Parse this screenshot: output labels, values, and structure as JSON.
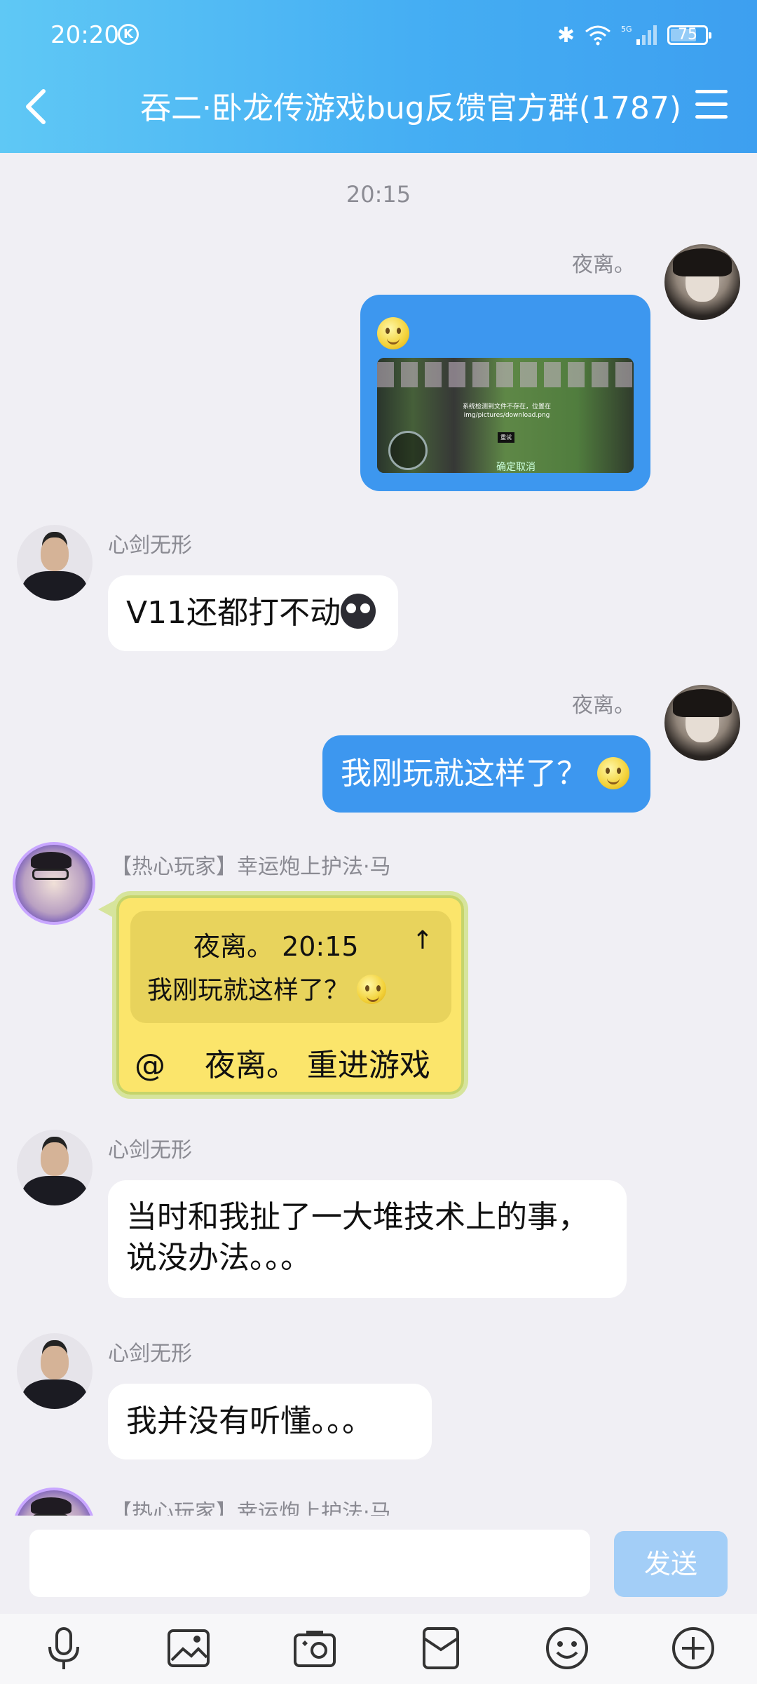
{
  "status": {
    "time": "20:20",
    "battery": "75",
    "battery_level": 0.75
  },
  "header": {
    "title": "吞二·卧龙传游戏bug反馈官方群(1787)"
  },
  "chat": {
    "timestamp": "20:15",
    "messages": [
      {
        "sender": "夜离。"
      },
      {
        "sender": "心剑无形",
        "text": "V11还都打不动"
      },
      {
        "sender": "夜离。",
        "text": "我刚玩就这样了？"
      },
      {
        "sender": "【热心玩家】幸运炮上护法·马",
        "quote_head": "夜离。 20:15",
        "quote_text": "我刚玩就这样了？",
        "text": "@    夜离。 重进游戏"
      },
      {
        "sender": "心剑无形",
        "text_line1": "当时和我扯了一大堆技术上的事，",
        "text_line2": "说没办法。。。"
      },
      {
        "sender": "心剑无形",
        "text": "我并没有听懂。。。"
      },
      {
        "sender": "【热心玩家】幸运炮上护法·马"
      }
    ],
    "screenshot": {
      "error_line1": "系统检测到文件不存在，位置在",
      "error_line2": "img/pictures/download.png",
      "retry": "重试",
      "confirm": "确定取消"
    }
  },
  "input": {
    "send_label": "发送",
    "value": ""
  },
  "toolbar": [
    "mic-icon",
    "image-icon",
    "camera-icon",
    "red-packet-icon",
    "emoji-icon",
    "plus-icon"
  ]
}
